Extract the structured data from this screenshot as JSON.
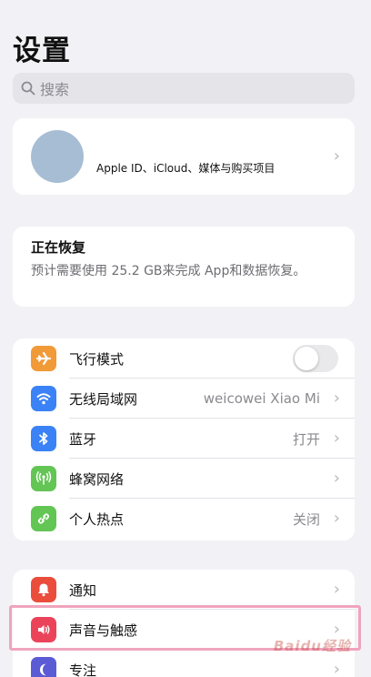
{
  "header": {
    "title": "设置"
  },
  "search": {
    "placeholder": "搜索",
    "icon": "search-icon"
  },
  "profile": {
    "text": "Apple ID、iCloud、媒体与购买项目",
    "avatar_color": "#a7bdd4"
  },
  "restore": {
    "title": "正在恢复",
    "description": "预计需要使用 25.2 GB来完成 App和数据恢复。"
  },
  "group1": {
    "items": [
      {
        "label": "飞行模式",
        "icon": "airplane-icon",
        "color": "#f19a38",
        "toggle": false
      },
      {
        "label": "无线局域网",
        "value": "weicowei Xiao Mi",
        "icon": "wifi-icon",
        "color": "#3a82f6"
      },
      {
        "label": "蓝牙",
        "value": "打开",
        "icon": "bluetooth-icon",
        "color": "#3a82f6"
      },
      {
        "label": "蜂窝网络",
        "icon": "cellular-icon",
        "color": "#62c554"
      },
      {
        "label": "个人热点",
        "value": "关闭",
        "icon": "hotspot-icon",
        "color": "#62c554"
      }
    ]
  },
  "group2": {
    "items": [
      {
        "label": "通知",
        "icon": "notification-icon",
        "color": "#eb4d3d"
      },
      {
        "label": "声音与触感",
        "icon": "speaker-icon",
        "color": "#eb445a"
      },
      {
        "label": "专注",
        "icon": "moon-icon",
        "color": "#5b5bd6"
      }
    ]
  },
  "watermark": {
    "text": "Baidu经验"
  },
  "chevron": "›"
}
